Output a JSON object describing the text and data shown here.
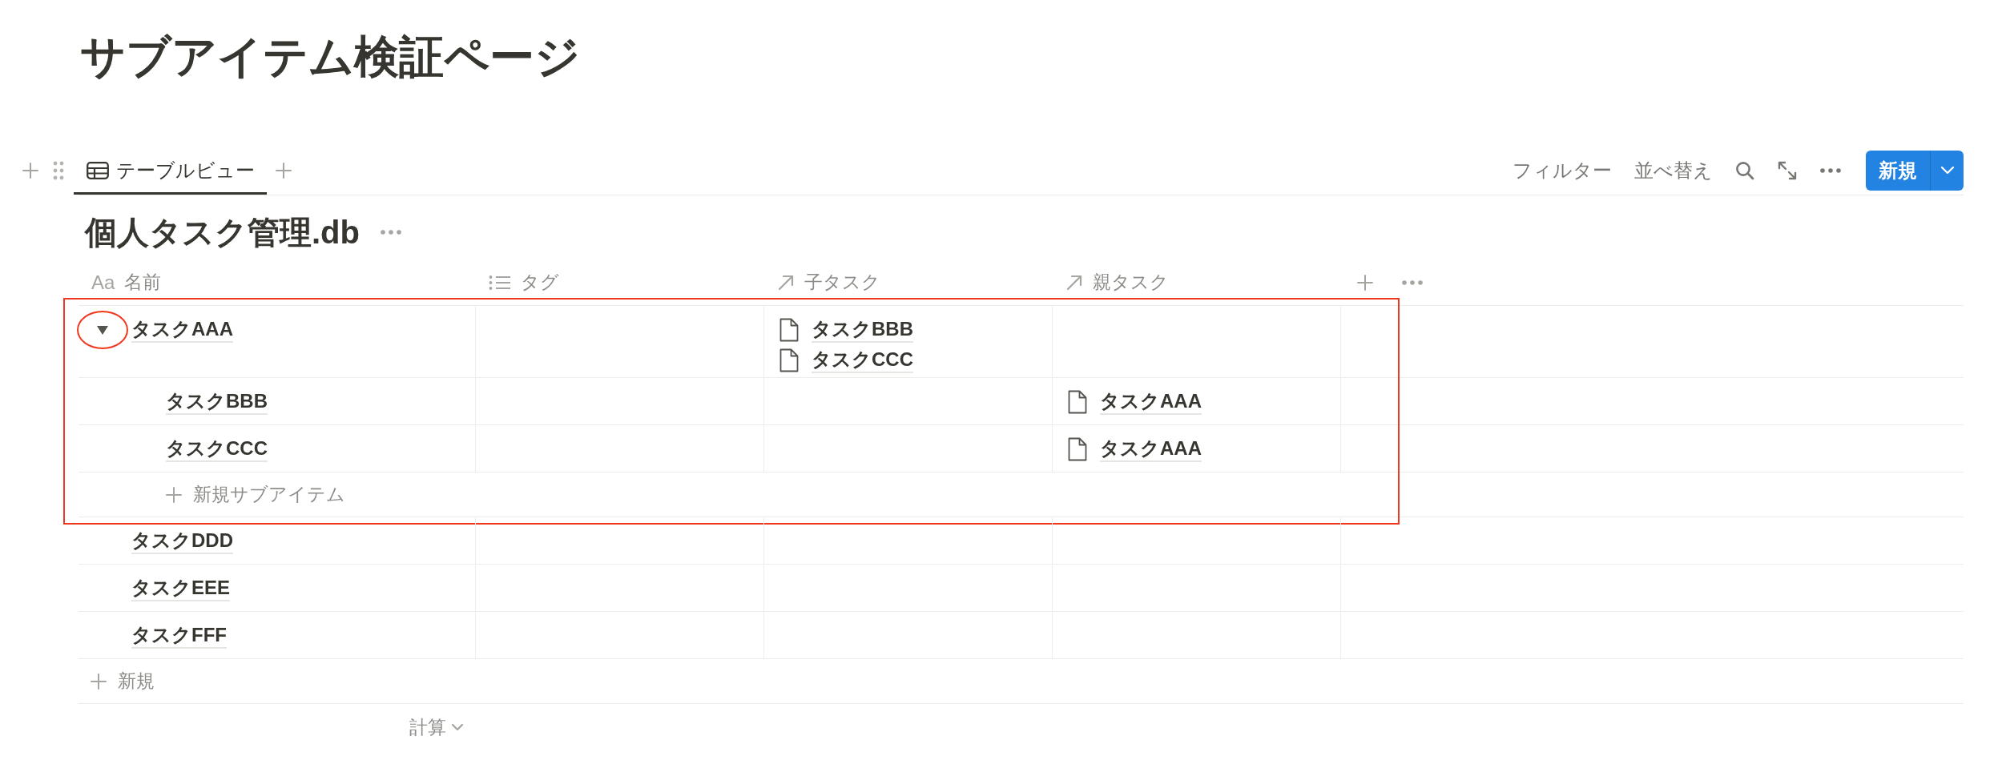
{
  "page": {
    "title": "サブアイテム検証ページ"
  },
  "view_bar": {
    "tabs": [
      {
        "label": "テーブルビュー",
        "selected": true
      }
    ],
    "filter_label": "フィルター",
    "sort_label": "並べ替え",
    "new_button": "新規"
  },
  "database": {
    "title": "個人タスク管理.db"
  },
  "table": {
    "columns": [
      {
        "label": "名前",
        "kind": "title",
        "type_mark": "Aa"
      },
      {
        "label": "タグ",
        "kind": "multi_select"
      },
      {
        "label": "子タスク",
        "kind": "relation"
      },
      {
        "label": "親タスク",
        "kind": "relation"
      }
    ],
    "rows": [
      {
        "name": "タスクAAA",
        "expanded": true,
        "highlighted": true,
        "sub_tasks": [
          "タスクBBB",
          "タスクCCC"
        ],
        "children": [
          {
            "name": "タスクBBB",
            "parent_tasks": [
              "タスクAAA"
            ]
          },
          {
            "name": "タスクCCC",
            "parent_tasks": [
              "タスクAAA"
            ]
          }
        ],
        "add_subitem_label": "新規サブアイテム"
      },
      {
        "name": "タスクDDD",
        "highlighted": false
      },
      {
        "name": "タスクEEE",
        "highlighted": false
      },
      {
        "name": "タスクFFF",
        "highlighted": false
      }
    ],
    "add_row_label": "新規",
    "calculate_label": "計算"
  }
}
